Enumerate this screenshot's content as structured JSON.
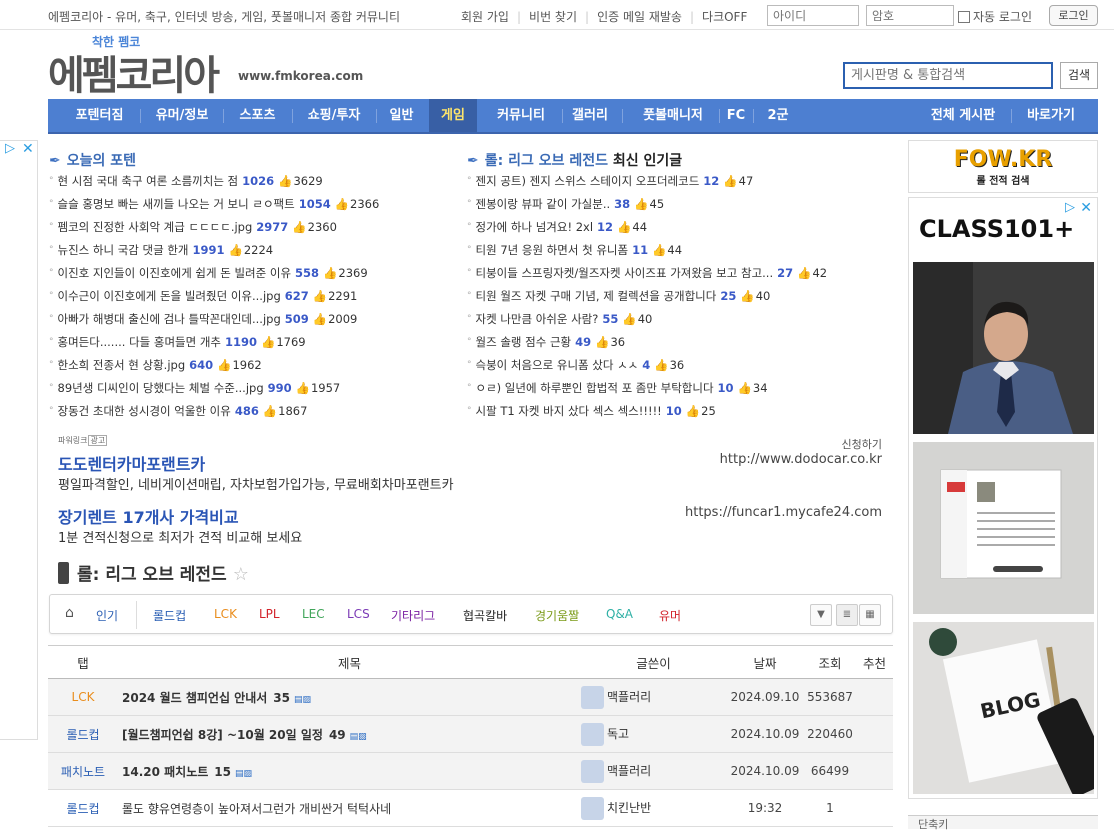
{
  "topbar": {
    "slogan": "에펨코리아 - 유머, 축구, 인터넷 방송, 게임, 풋볼매니저 종합 커뮤니티",
    "links": [
      "회원 가입",
      "비번 찾기",
      "인증 메일 재발송",
      "다크OFF"
    ],
    "id_placeholder": "아이디",
    "pw_placeholder": "암호",
    "auto_login": "자동 로그인",
    "login_button": "로그인"
  },
  "header": {
    "logo_small": "착한 펨코",
    "logo_text": "에펨코리아",
    "site_url": "www.fmkorea.com",
    "search_placeholder": "게시판명 & 통합검색",
    "search_button": "검색"
  },
  "nav": {
    "items": [
      "포텐터짐",
      "유머/정보",
      "스포츠",
      "쇼핑/투자",
      "일반",
      "게임",
      "커뮤니티",
      "갤러리",
      "풋볼매니저",
      "FC",
      "2군"
    ],
    "active": "게임",
    "right_items": [
      "전체 게시판",
      "바로가기"
    ]
  },
  "ad_left": {
    "badge": "▷",
    "close": "✕"
  },
  "potential": {
    "title": "오늘의 포텐",
    "items": [
      {
        "title": "현 시점 국대 축구 여론 소름끼치는 점",
        "comments": "1026",
        "likes": "3629"
      },
      {
        "title": "슬슬 홍명보 빠는 새끼들 나오는 거 보니 ㄹㅇ팩트",
        "comments": "1054",
        "likes": "2366"
      },
      {
        "title": "펨코의 진정한 사회악 계급 ㄷㄷㄷㄷ.jpg",
        "comments": "2977",
        "likes": "2360"
      },
      {
        "title": "뉴진스 하니 국감 댓글 한개",
        "comments": "1991",
        "likes": "2224"
      },
      {
        "title": "이진호 지인들이 이진호에게 쉽게 돈 빌려준 이유",
        "comments": "558",
        "likes": "2369"
      },
      {
        "title": "이수근이 이진호에게 돈을 빌려줬던 이유...jpg",
        "comments": "627",
        "likes": "2291"
      },
      {
        "title": "아빠가 해병대 출신에 검나 틀딱꼰대인데...jpg",
        "comments": "509",
        "likes": "2009"
      },
      {
        "title": "홍며든다....... 다들 홍며들면 개추",
        "comments": "1190",
        "likes": "1769"
      },
      {
        "title": "한소희 전종서 현 상황.jpg",
        "comments": "640",
        "likes": "1962"
      },
      {
        "title": "89년생 디씨인이 당했다는 체벌 수준...jpg",
        "comments": "990",
        "likes": "1957"
      },
      {
        "title": "장동건 초대한 성시경이 억울한 이유",
        "comments": "486",
        "likes": "1867"
      }
    ]
  },
  "lol_hot": {
    "title_board": "롤: 리그 오브 레전드",
    "title_suffix": "최신 인기글",
    "items": [
      {
        "title": "젠지 공트) 젠지 스위스 스테이지 오프더레코드",
        "comments": "12",
        "likes": "47"
      },
      {
        "title": "젠봉이랑 뷰파 같이 가실분..",
        "comments": "38",
        "likes": "45"
      },
      {
        "title": "정가에 하나 넘겨요! 2xl",
        "comments": "12",
        "likes": "44"
      },
      {
        "title": "티원 7년 응원 하면서 첫 유니폼",
        "comments": "11",
        "likes": "44"
      },
      {
        "title": "티붕이들 스프링자켓/월즈자켓 사이즈표 가져왔음 보고 참고...",
        "comments": "27",
        "likes": "42"
      },
      {
        "title": "티원 월즈 자켓 구매 기념, 제 컬렉션을 공개합니다",
        "comments": "25",
        "likes": "40"
      },
      {
        "title": "자켓 나만큼 아쉬운 사람?",
        "comments": "55",
        "likes": "40"
      },
      {
        "title": "월즈 솔랭 점수 근황",
        "comments": "49",
        "likes": "36"
      },
      {
        "title": "슥붕이 처음으로 유니폼 샀다 ㅅㅅ",
        "comments": "4",
        "likes": "36"
      },
      {
        "title": "ㅇㄹ) 일년에 하루뿐인 합법적 포 좀만 부탁합니다",
        "comments": "10",
        "likes": "34"
      },
      {
        "title": "시팔 T1 자켓 바지 샀다 섹스 섹스!!!!!",
        "comments": "10",
        "likes": "25"
      }
    ]
  },
  "powerlink": {
    "label": "파워링크",
    "ad_tag": "광고",
    "apply": "신청하기",
    "ads": [
      {
        "title": "도도렌터카마포랜트카",
        "desc": "평일파격할인, 네비게이션매립, 자차보험가입가능, 무료배회차마포랜트카",
        "url": "http://www.dodocar.co.kr"
      },
      {
        "title": "장기렌트 17개사 가격비교",
        "desc": "1분 견적신청으로 최저가 견적 비교해 보세요",
        "url": "https://funcar1.mycafe24.com"
      }
    ]
  },
  "board": {
    "title": "롤: 리그 오브 레전드",
    "tabs": [
      {
        "label": "인기",
        "color": "#2b5fb4"
      },
      {
        "label": "롤드컵",
        "color": "#2b5fb4"
      },
      {
        "label": "LCK",
        "color": "#e98d1d"
      },
      {
        "label": "LPL",
        "color": "#d2232a"
      },
      {
        "label": "LEC",
        "color": "#41a55a"
      },
      {
        "label": "LCS",
        "color": "#7b3ab5"
      },
      {
        "label": "기타리그",
        "color": "#7a1fa2"
      },
      {
        "label": "협곡칼바",
        "color": "#222222"
      },
      {
        "label": "경기움짤",
        "color": "#7a9a17"
      },
      {
        "label": "Q&A",
        "color": "#2fb0a5"
      },
      {
        "label": "유머",
        "color": "#d2232a"
      }
    ],
    "columns": [
      "탭",
      "제목",
      "글쓴이",
      "날짜",
      "조회",
      "추천"
    ],
    "rows": [
      {
        "tab": "LCK",
        "tab_color": "#e98d1d",
        "title": "2024 월드 챔피언십 안내서",
        "comments": "35",
        "author": "맥플러리",
        "date": "2024.09.10",
        "views": "553687",
        "notice": true
      },
      {
        "tab": "롤드컵",
        "tab_color": "#2b5fb4",
        "title": "[월드챔피언쉽 8강] ~10월 20일 일정",
        "comments": "49",
        "author": "독고",
        "date": "2024.10.09",
        "views": "220460",
        "notice": true
      },
      {
        "tab": "패치노트",
        "tab_color": "#2b5fb4",
        "title": "14.20 패치노트",
        "comments": "15",
        "author": "맥플러리",
        "date": "2024.10.09",
        "views": "66499",
        "notice": true
      },
      {
        "tab": "롤드컵",
        "tab_color": "#2b5fb4",
        "title": "롤도 향유연령층이 높아져서그런가 개비싼거 턱턱사네",
        "comments": "",
        "author": "치킨난반",
        "date": "19:32",
        "views": "1",
        "notice": false
      }
    ]
  },
  "right": {
    "fow_title": "FOW.KR",
    "fow_sub": "롤 전적 검색",
    "class_brand": "CLASS101+",
    "ad_badge": "▷",
    "ad_close": "✕",
    "blog_text": "BLOG",
    "bottom_label": "단축키"
  }
}
